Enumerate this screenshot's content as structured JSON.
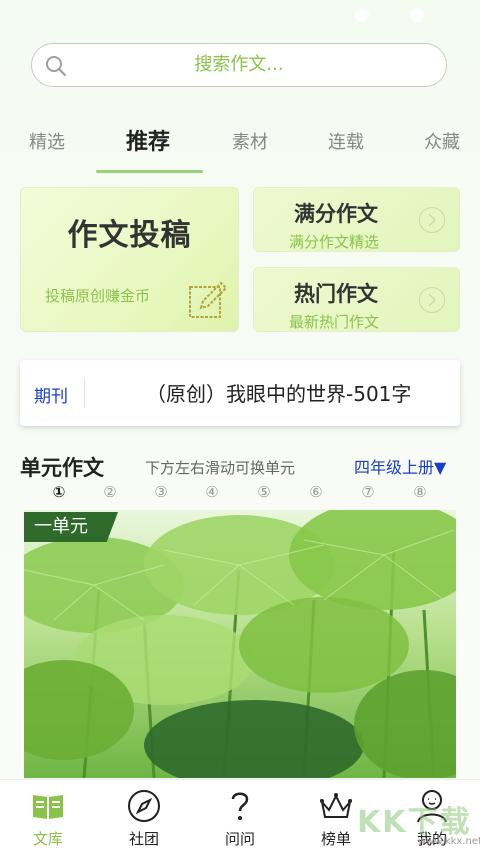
{
  "search": {
    "placeholder": "搜索作文..."
  },
  "tabs": [
    {
      "label": "精选",
      "active": false
    },
    {
      "label": "推荐",
      "active": true
    },
    {
      "label": "素材",
      "active": false
    },
    {
      "label": "连载",
      "active": false
    },
    {
      "label": "众藏",
      "active": false
    }
  ],
  "cards": {
    "main": {
      "title": "作文投稿",
      "subtitle": "投稿原创赚金币",
      "icon": "edit-icon"
    },
    "full_score": {
      "title": "满分作文",
      "subtitle": "满分作文精选",
      "icon": "chevron-right-icon"
    },
    "hot": {
      "title": "热门作文",
      "subtitle": "最新热门作文",
      "icon": "chevron-right-icon"
    }
  },
  "periodical": {
    "label": "期刊",
    "text": "（原创）我眼中的世界-501字"
  },
  "units": {
    "title": "单元作文",
    "hint": "下方左右滑动可换单元",
    "grade": "四年级上册▼",
    "numbers": [
      "①",
      "②",
      "③",
      "④",
      "⑤",
      "⑥",
      "⑦",
      "⑧"
    ],
    "active_index": 0,
    "banner_label": "一单元"
  },
  "tabbar": [
    {
      "label": "文库",
      "icon": "book-icon",
      "active": true
    },
    {
      "label": "社团",
      "icon": "compass-icon",
      "active": false
    },
    {
      "label": "问问",
      "icon": "question-icon",
      "active": false
    },
    {
      "label": "榜单",
      "icon": "crown-icon",
      "active": false
    },
    {
      "label": "我的",
      "icon": "profile-icon",
      "active": false
    }
  ],
  "watermark": {
    "text": "KK下载",
    "url": "www.kkx.net"
  },
  "colors": {
    "accent": "#8bc34a",
    "link_blue": "#1a3fbf",
    "ribbon": "#2f6a2b"
  }
}
